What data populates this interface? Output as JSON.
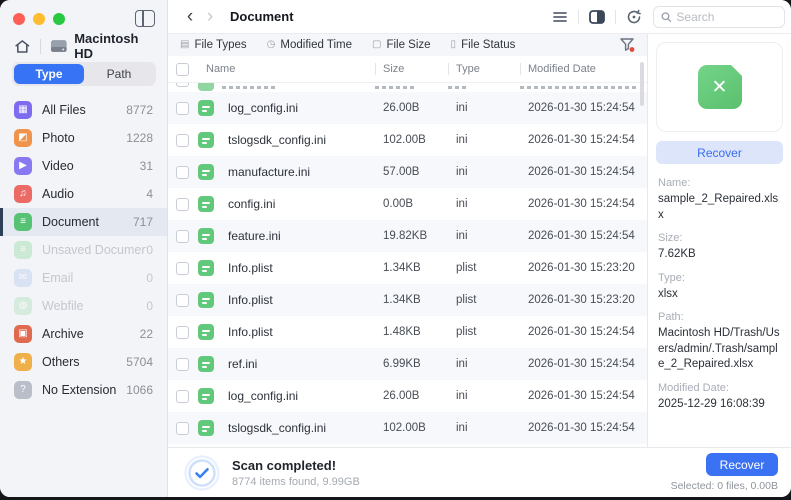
{
  "sidebar": {
    "device_label": "Macintosh HD",
    "segmented": {
      "options": [
        "Type",
        "Path"
      ],
      "selected": "Type"
    },
    "items": [
      {
        "label": "All Files",
        "count": "8772",
        "glyph": "▦",
        "color": "#7d6bf0",
        "selected": false,
        "disabled": false
      },
      {
        "label": "Photo",
        "count": "1228",
        "glyph": "◩",
        "color": "#f0944d",
        "selected": false,
        "disabled": false
      },
      {
        "label": "Video",
        "count": "31",
        "glyph": "▶",
        "color": "#8878f2",
        "selected": false,
        "disabled": false
      },
      {
        "label": "Audio",
        "count": "4",
        "glyph": "♫",
        "color": "#ec6a66",
        "selected": false,
        "disabled": false
      },
      {
        "label": "Document",
        "count": "717",
        "glyph": "≡",
        "color": "#57c273",
        "selected": true,
        "disabled": false
      },
      {
        "label": "Unsaved Documents",
        "count": "0",
        "glyph": "≡",
        "color": "#9fdcb0",
        "selected": false,
        "disabled": true
      },
      {
        "label": "Email",
        "count": "0",
        "glyph": "✉",
        "color": "#b9cef0",
        "selected": false,
        "disabled": true
      },
      {
        "label": "Webfile",
        "count": "0",
        "glyph": "◍",
        "color": "#b2e2c1",
        "selected": false,
        "disabled": true
      },
      {
        "label": "Archive",
        "count": "22",
        "glyph": "▣",
        "color": "#e06a4f",
        "selected": false,
        "disabled": false
      },
      {
        "label": "Others",
        "count": "5704",
        "glyph": "★",
        "color": "#f0b049",
        "selected": false,
        "disabled": false
      },
      {
        "label": "No Extension",
        "count": "1066",
        "glyph": "?",
        "color": "#b9bec8",
        "selected": false,
        "disabled": false
      }
    ]
  },
  "toolbar": {
    "title": "Document",
    "search_placeholder": "Search"
  },
  "filters": {
    "items": [
      {
        "label": "File Types",
        "glyph": "▤"
      },
      {
        "label": "Modified Time",
        "glyph": "◷"
      },
      {
        "label": "File Size",
        "glyph": "▢"
      },
      {
        "label": "File Status",
        "glyph": "▯"
      }
    ]
  },
  "table": {
    "columns": [
      "Name",
      "Size",
      "Type",
      "Modified Date"
    ],
    "rows": [
      {
        "name": "log_config.ini",
        "size": "26.00B",
        "type": "ini",
        "modified": "2026-01-30 15:24:54"
      },
      {
        "name": "tslogsdk_config.ini",
        "size": "102.00B",
        "type": "ini",
        "modified": "2026-01-30 15:24:54"
      },
      {
        "name": "manufacture.ini",
        "size": "57.00B",
        "type": "ini",
        "modified": "2026-01-30 15:24:54"
      },
      {
        "name": "config.ini",
        "size": "0.00B",
        "type": "ini",
        "modified": "2026-01-30 15:24:54"
      },
      {
        "name": "feature.ini",
        "size": "19.82KB",
        "type": "ini",
        "modified": "2026-01-30 15:24:54"
      },
      {
        "name": "Info.plist",
        "size": "1.34KB",
        "type": "plist",
        "modified": "2026-01-30 15:23:20"
      },
      {
        "name": "Info.plist",
        "size": "1.34KB",
        "type": "plist",
        "modified": "2026-01-30 15:23:20"
      },
      {
        "name": "Info.plist",
        "size": "1.48KB",
        "type": "plist",
        "modified": "2026-01-30 15:24:54"
      },
      {
        "name": "ref.ini",
        "size": "6.99KB",
        "type": "ini",
        "modified": "2026-01-30 15:24:54"
      },
      {
        "name": "log_config.ini",
        "size": "26.00B",
        "type": "ini",
        "modified": "2026-01-30 15:24:54"
      },
      {
        "name": "tslogsdk_config.ini",
        "size": "102.00B",
        "type": "ini",
        "modified": "2026-01-30 15:24:54"
      }
    ]
  },
  "details": {
    "preview_glyph": "✕",
    "recover_label": "Recover",
    "fields": [
      {
        "label": "Name:",
        "value": "sample_2_Repaired.xlsx"
      },
      {
        "label": "Size:",
        "value": "7.62KB"
      },
      {
        "label": "Type:",
        "value": "xlsx"
      },
      {
        "label": "Path:",
        "value": "Macintosh HD/Trash/Users/admin/.Trash/sample_2_Repaired.xlsx"
      },
      {
        "label": "Modified Date:",
        "value": "2025-12-29 16:08:39"
      }
    ]
  },
  "statusbar": {
    "title": "Scan completed!",
    "subtitle": "8774 items found, 9.99GB",
    "recover_label": "Recover",
    "selected_text": "Selected: 0 files, 0.00B"
  },
  "colors": {
    "accent": "#3673f5",
    "document_green": "#62c97c",
    "stripe": "#f7f8fb",
    "sidebar_bg": "#f3f4f7"
  }
}
